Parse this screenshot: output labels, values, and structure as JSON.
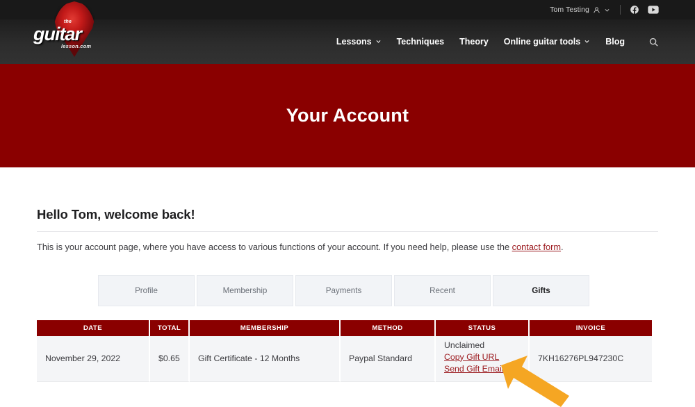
{
  "header": {
    "topbar": {
      "user_name": "Tom Testing",
      "user_icon": "person-icon",
      "chevron_icon": "chevron-down-icon",
      "facebook_icon": "facebook-icon",
      "youtube_icon": "youtube-icon"
    },
    "logo": {
      "the": "the",
      "main": "guitar",
      "sub": "lesson.com",
      "shape": "guitar-pick"
    },
    "nav": [
      {
        "label": "Lessons",
        "has_dropdown": true
      },
      {
        "label": "Techniques",
        "has_dropdown": false
      },
      {
        "label": "Theory",
        "has_dropdown": false
      },
      {
        "label": "Online guitar tools",
        "has_dropdown": true
      },
      {
        "label": "Blog",
        "has_dropdown": false
      }
    ],
    "search_icon": "search-icon"
  },
  "hero": {
    "title": "Your Account",
    "bg_color": "#8a0000"
  },
  "main": {
    "greeting": "Hello Tom, welcome back!",
    "intro_before": "This is your account page, where you have access to various functions of your account. If you need help, please use the ",
    "intro_link": "contact form",
    "intro_after": ".",
    "tabs": [
      {
        "label": "Profile",
        "active": false
      },
      {
        "label": "Membership",
        "active": false
      },
      {
        "label": "Payments",
        "active": false
      },
      {
        "label": "Recent",
        "active": false
      },
      {
        "label": "Gifts",
        "active": true
      }
    ],
    "table": {
      "columns": [
        "DATE",
        "TOTAL",
        "MEMBERSHIP",
        "METHOD",
        "STATUS",
        "INVOICE"
      ],
      "rows": [
        {
          "date": "November 29, 2022",
          "total": "$0.65",
          "membership": "Gift Certificate - 12 Months",
          "method": "Paypal Standard",
          "status_text": "Unclaimed",
          "status_links": [
            "Copy Gift URL",
            "Send Gift Email"
          ],
          "invoice": "7KH16276PL947230C"
        }
      ]
    }
  },
  "annotation": {
    "arrow_icon": "arrow-up-left-icon",
    "arrow_color": "#F5A623",
    "points_at": "Send Gift Email"
  },
  "colors": {
    "brand_red": "#8a0000",
    "link_red": "#9c1b20",
    "header_dark": "#1e1e1e",
    "tab_bg": "#f2f4f7",
    "row_bg": "#f4f5f7"
  }
}
